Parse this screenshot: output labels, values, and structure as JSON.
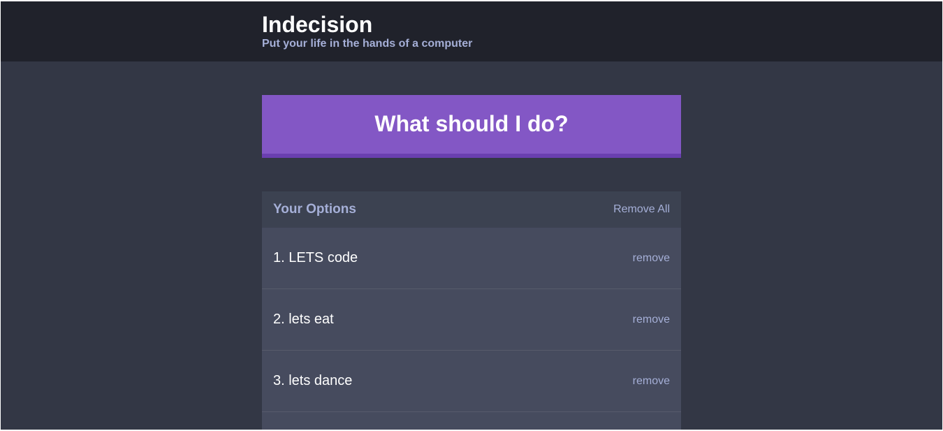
{
  "header": {
    "title": "Indecision",
    "subtitle": "Put your life in the hands of a computer"
  },
  "action": {
    "label": "What should I do?"
  },
  "options_panel": {
    "title": "Your Options",
    "remove_all_label": "Remove All",
    "items": [
      {
        "text": "1. LETS code",
        "remove_label": "remove"
      },
      {
        "text": "2. lets eat",
        "remove_label": "remove"
      },
      {
        "text": "3. lets dance",
        "remove_label": "remove"
      }
    ]
  },
  "colors": {
    "header_bg": "#20222b",
    "page_bg": "#333745",
    "accent": "#8357c5",
    "accent_dark": "#6a3fb0",
    "widget_header_bg": "#3c4251",
    "widget_bg": "#464b5e",
    "muted_text": "#a5afd7"
  }
}
